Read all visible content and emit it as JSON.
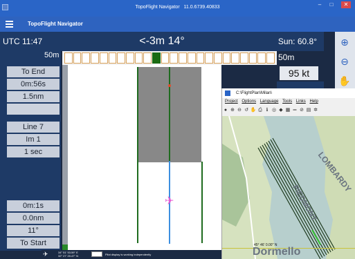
{
  "window": {
    "title": "TopoFlight Navigator",
    "version": "11.0.6739.40833",
    "controls": [
      "–",
      "□",
      "✕"
    ]
  },
  "app": {
    "name": "TopoFlight Navigator"
  },
  "header": {
    "utc": "UTC 11:47",
    "deviation": "<-3m 14°",
    "sun": "Sun: 60.8°"
  },
  "scale": {
    "left": "50m",
    "right": "50m"
  },
  "speed": "95 kt",
  "left_panel": {
    "to_end": "To End",
    "time_to_end": "0m:56s",
    "distance_to_end": "1.5nm",
    "line": "Line 7",
    "image": "Im 1",
    "interval": "1 sec",
    "time_to_start": "0m:1s",
    "distance_to_start": "0.0nm",
    "angle": "11°",
    "to_start": "To Start"
  },
  "trackbar": {
    "cells": 24,
    "active_index": 10
  },
  "right_toolbar": [
    {
      "name": "zoom-in-icon",
      "glyph": "⊕"
    },
    {
      "name": "zoom-out-icon",
      "glyph": "⊖"
    },
    {
      "name": "pan-hand-icon",
      "glyph": "✋"
    }
  ],
  "status": {
    "coords_line1": "34° 51' 53.59'' E",
    "coords_line2": "32° 27' 20.47'' N",
    "message": "Pilot display is working independently"
  },
  "overlay": {
    "path": "C:\\FlightPlan\\Milan\\",
    "menu": [
      "Project",
      "Options",
      "Language",
      "Tools",
      "Links",
      "Help"
    ],
    "latitude": "45° 46' 0.00'' N",
    "map_labels": [
      "LOMBARDY",
      "PIEDMONT",
      "Dormello"
    ]
  },
  "colors": {
    "titlebar": "#2a65c7",
    "panel": "#1e3a66",
    "track_active": "#1b6b12",
    "aircraft": "#e85dd3"
  }
}
